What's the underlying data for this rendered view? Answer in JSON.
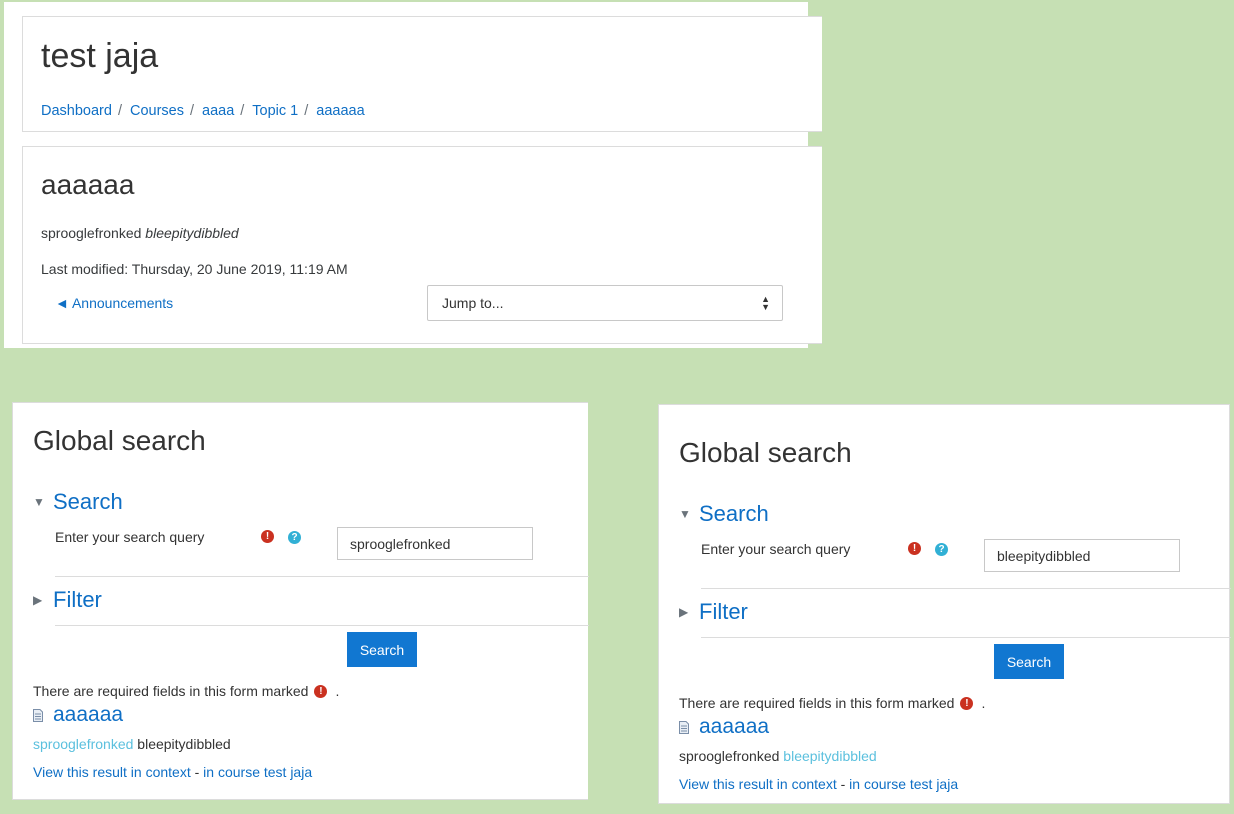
{
  "header": {
    "title": "test jaja",
    "breadcrumb": [
      "Dashboard",
      "Courses",
      "aaaa",
      "Topic 1",
      "aaaaaa"
    ],
    "separator": "/"
  },
  "activity": {
    "title": "aaaaaa",
    "description_plain": "sprooglefronked ",
    "description_em": "bleepitydibbled",
    "last_modified": "Last modified: Thursday, 20 June 2019, 11:19 AM",
    "prev_link": "◄ Announcements",
    "jump_to": "Jump to..."
  },
  "panels": [
    {
      "title": "Global search",
      "search_section": "Search",
      "filter_section": "Filter",
      "field_label": "Enter your search query",
      "query": "sprooglefronked",
      "button": "Search",
      "required_note": "There are required fields in this form marked",
      "required_note_end": ".",
      "result_title": "aaaaaa",
      "snippet_first": "sprooglefronked",
      "snippet_second": "bleepitydibbled",
      "context_link": "View this result in context",
      "context_sep": " - ",
      "course_link": "in course test jaja"
    },
    {
      "title": "Global search",
      "search_section": "Search",
      "filter_section": "Filter",
      "field_label": "Enter your search query",
      "query": "bleepitydibbled",
      "button": "Search",
      "required_note": "There are required fields in this form marked",
      "required_note_end": ".",
      "result_title": "aaaaaa",
      "snippet_first": "sprooglefronked",
      "snippet_second": "bleepitydibbled",
      "context_link": "View this result in context",
      "context_sep": " - ",
      "course_link": "in course test jaja"
    }
  ],
  "icons": {
    "required": "exclamation-circle-icon",
    "help": "question-circle-icon",
    "result": "document-icon"
  },
  "colors": {
    "background": "#c6e0b4",
    "link": "#0f6fc5",
    "button": "#1177d1",
    "required": "#ca3120",
    "help": "#31b0d5",
    "highlight": "#5bc0de"
  }
}
